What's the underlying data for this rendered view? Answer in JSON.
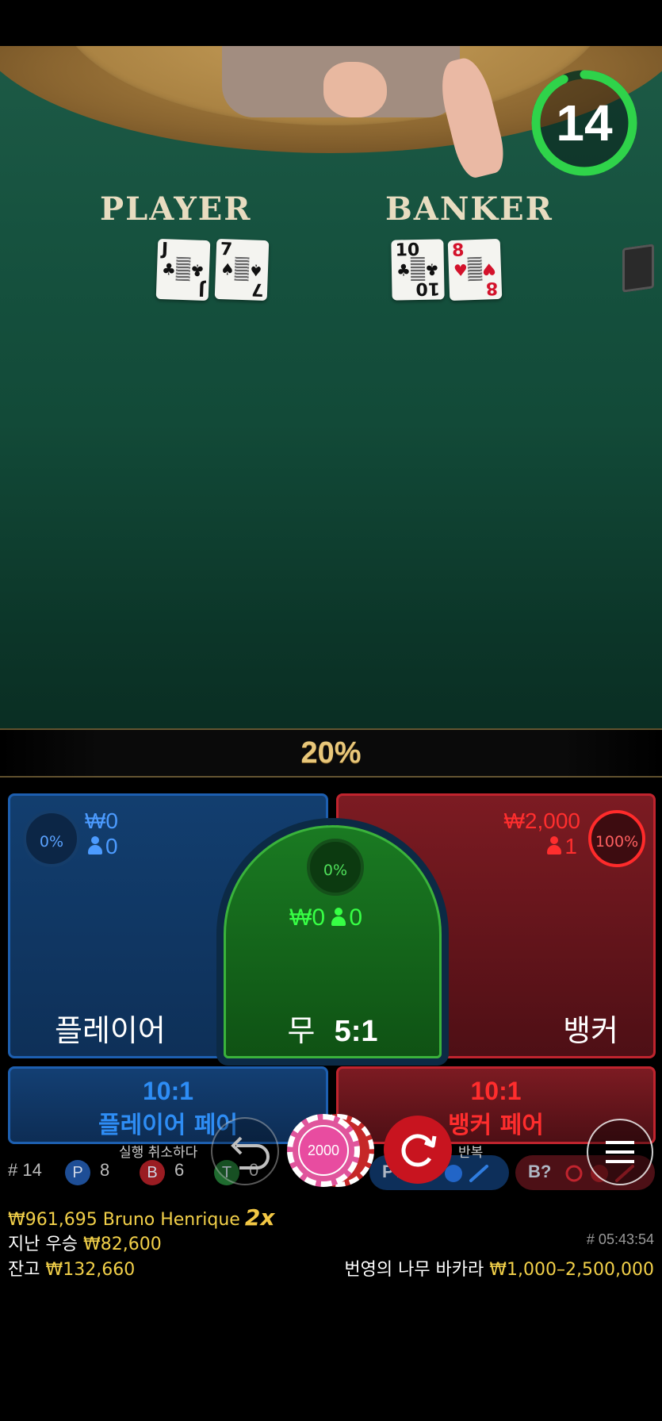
{
  "timer": {
    "value": "14",
    "progress": 0.93,
    "color": "#2fd34a"
  },
  "table": {
    "player_label": "PLAYER",
    "banker_label": "BANKER",
    "player_cards": [
      {
        "rank": "J",
        "suit": "♣",
        "color": "black"
      },
      {
        "rank": "7",
        "suit": "♠",
        "color": "black"
      }
    ],
    "banker_cards": [
      {
        "rank": "10",
        "suit": "♣",
        "color": "black"
      },
      {
        "rank": "8",
        "suit": "♥",
        "color": "red"
      }
    ]
  },
  "multiplier": "20%",
  "bets": {
    "player": {
      "pct": "0%",
      "amount": "₩0",
      "count": "0",
      "label": "플레이어"
    },
    "tie": {
      "pct": "0%",
      "amount": "₩0",
      "count": "0",
      "label": "무",
      "odds": "5:1"
    },
    "banker": {
      "pct": "100%",
      "amount": "₩2,000",
      "count": "1",
      "label": "뱅커"
    },
    "player_pair": {
      "odds": "10:1",
      "label": "플레이어 페어"
    },
    "banker_pair": {
      "odds": "10:1",
      "label": "뱅커 페어"
    }
  },
  "controls": {
    "undo_label": "실행 취소하다",
    "chip_value": "2000",
    "repeat_label": "반복"
  },
  "stats": {
    "round": "# 14",
    "player_letter": "P",
    "player_count": "8",
    "banker_letter": "B",
    "banker_count": "6",
    "tie_letter": "T",
    "tie_count": "0",
    "player_pred": "P?",
    "banker_pred": "B?"
  },
  "info": {
    "winner_amount": "₩961,695",
    "winner_name": "Bruno Henrique",
    "winner_mult": "2x",
    "last_win_label": "지난 우승",
    "last_win_amount": "₩82,600",
    "balance_label": "잔고",
    "balance_amount": "₩132,660",
    "round_clock": "# 05:43:54",
    "table_name": "번영의 나무 바카라",
    "limits": "₩1,000–2,500,000"
  }
}
